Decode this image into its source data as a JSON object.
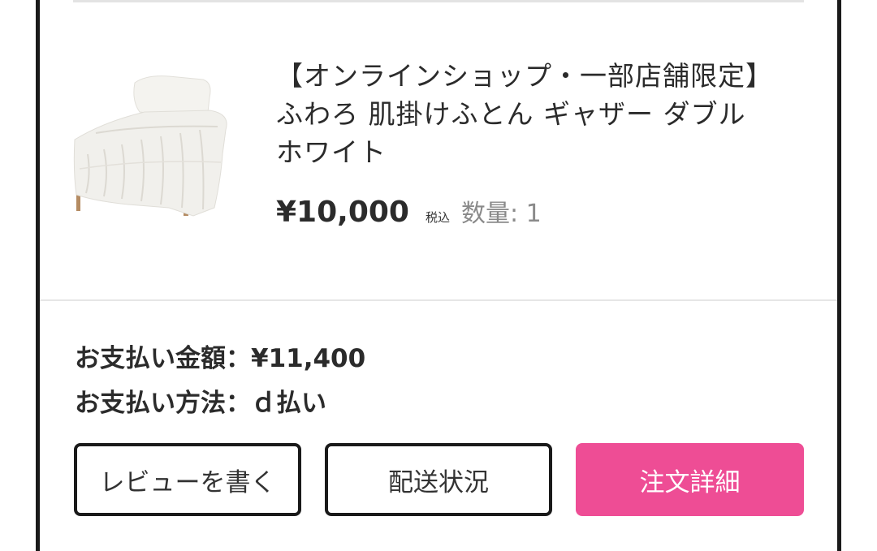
{
  "product": {
    "title_line1": "【オンラインショップ・一部店舗限定】",
    "title_line2": "ふわろ 肌掛けふとん ギャザー ダブル",
    "title_line3": "ホワイト",
    "price": "¥10,000",
    "tax_label": "税込",
    "quantity": "数量: 1",
    "image_icon": "bed-comforter-photo"
  },
  "summary": {
    "amount_line": "お支払い金額：¥11,400",
    "method_line": "お支払い方法：ｄ払い"
  },
  "buttons": {
    "review": "レビューを書く",
    "shipping": "配送状況",
    "detail": "注文詳細"
  },
  "colors": {
    "accent": "#ee4d95",
    "border": "#1a1a1a",
    "quantity_text": "#8a8a8a"
  }
}
